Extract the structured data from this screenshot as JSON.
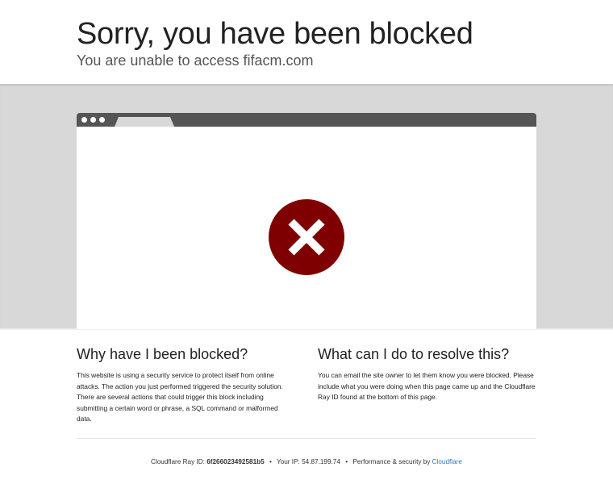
{
  "header": {
    "title": "Sorry, you have been blocked",
    "subtitle": "You are unable to access fifacm.com"
  },
  "icons": {
    "block": "x-circle-icon",
    "block_color": "#7f0000",
    "browser_bar_color": "#555555",
    "band_color": "#d8d8d8"
  },
  "why": {
    "heading": "Why have I been blocked?",
    "body": "This website is using a security service to protect itself from online attacks. The action you just performed triggered the security solution. There are several actions that could trigger this block including submitting a certain word or phrase, a SQL command or malformed data."
  },
  "resolve": {
    "heading": "What can I do to resolve this?",
    "body": "You can email the site owner to let them know you were blocked. Please include what you were doing when this page came up and the Cloudflare Ray ID found at the bottom of this page."
  },
  "footer": {
    "ray_label": "Cloudflare Ray ID:",
    "ray_id": "6f266023492581b5",
    "separator": "•",
    "ip_label": "Your IP:",
    "ip_value": "54.87.199.74",
    "perf_label": "Performance & security by",
    "cloudflare_link": "Cloudflare",
    "link_color": "#2f7bbf"
  }
}
